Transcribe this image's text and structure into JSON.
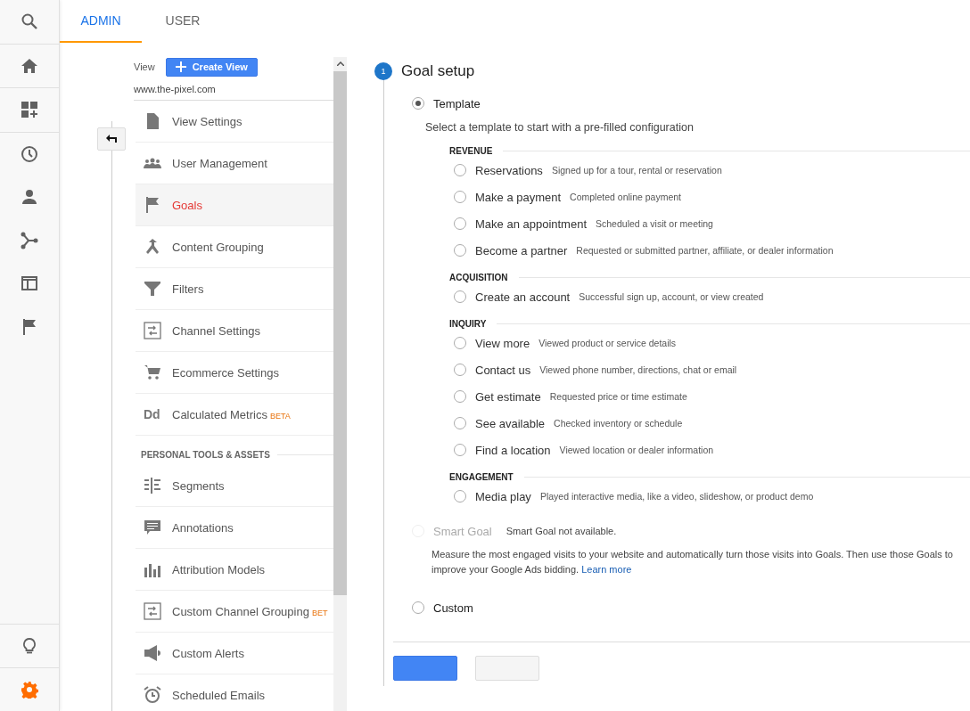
{
  "rail": {
    "top": [
      {
        "kind": "search",
        "selected": false
      },
      {
        "kind": "home",
        "selected": false
      },
      {
        "kind": "dashboard",
        "selected": false
      },
      {
        "kind": "clock",
        "selected": false
      },
      {
        "kind": "person",
        "selected": false
      },
      {
        "kind": "share",
        "selected": false
      },
      {
        "kind": "layout",
        "selected": false
      },
      {
        "kind": "flag",
        "selected": false
      }
    ],
    "bottom": [
      {
        "kind": "bulb",
        "selected": false
      },
      {
        "kind": "gear",
        "selected": true
      }
    ]
  },
  "tabs": [
    {
      "label": "ADMIN",
      "selected": true
    },
    {
      "label": "USER",
      "selected": false
    }
  ],
  "view_panel": {
    "label": "View",
    "create_button": "Create View",
    "view_name": "www.the-pixel.com",
    "groups": [
      {
        "items": [
          {
            "label": "View Settings",
            "kind": "doc",
            "selected": false
          },
          {
            "label": "User Management",
            "kind": "people",
            "selected": false
          },
          {
            "label": "Goals",
            "kind": "flag",
            "selected": true
          },
          {
            "label": "Content Grouping",
            "kind": "merge",
            "selected": false
          },
          {
            "label": "Filters",
            "kind": "filter",
            "selected": false
          },
          {
            "label": "Channel Settings",
            "kind": "channel",
            "selected": false
          },
          {
            "label": "Ecommerce Settings",
            "kind": "cart",
            "selected": false
          },
          {
            "label": "Calculated Metrics",
            "kind": "dd",
            "icon_text": "Dd",
            "selected": false,
            "badge": "BETA"
          }
        ]
      },
      {
        "heading": "PERSONAL TOOLS & ASSETS",
        "items": [
          {
            "label": "Segments",
            "kind": "segments",
            "selected": false
          },
          {
            "label": "Annotations",
            "kind": "comment",
            "selected": false
          },
          {
            "label": "Attribution Models",
            "kind": "bars",
            "selected": false
          },
          {
            "label": "Custom Channel Grouping",
            "kind": "channel",
            "selected": false,
            "badge": "BET"
          },
          {
            "label": "Custom Alerts",
            "kind": "megaphone",
            "selected": false
          },
          {
            "label": "Scheduled Emails",
            "kind": "alarm",
            "selected": false
          }
        ]
      }
    ]
  },
  "goal_setup": {
    "step": "1",
    "title": "Goal setup",
    "options": [
      {
        "kind": "template",
        "label": "Template",
        "selected": true,
        "disabled": false,
        "description": "Select a template to start with a pre-filled configuration",
        "categories": [
          {
            "name": "REVENUE",
            "templates": [
              {
                "label": "Reservations",
                "description": "Signed up for a tour, rental or reservation",
                "selected": false
              },
              {
                "label": "Make a payment",
                "description": "Completed online payment",
                "selected": false
              },
              {
                "label": "Make an appointment",
                "description": "Scheduled a visit or meeting",
                "selected": false
              },
              {
                "label": "Become a partner",
                "description": "Requested or submitted partner, affiliate, or dealer information",
                "selected": false
              }
            ]
          },
          {
            "name": "ACQUISITION",
            "templates": [
              {
                "label": "Create an account",
                "description": "Successful sign up, account, or view created",
                "selected": false
              }
            ]
          },
          {
            "name": "INQUIRY",
            "templates": [
              {
                "label": "View more",
                "description": "Viewed product or service details",
                "selected": false
              },
              {
                "label": "Contact us",
                "description": "Viewed phone number, directions, chat or email",
                "selected": false
              },
              {
                "label": "Get estimate",
                "description": "Requested price or time estimate",
                "selected": false
              },
              {
                "label": "See available",
                "description": "Checked inventory or schedule",
                "selected": false
              },
              {
                "label": "Find a location",
                "description": "Viewed location or dealer information",
                "selected": false
              }
            ]
          },
          {
            "name": "ENGAGEMENT",
            "templates": [
              {
                "label": "Media play",
                "description": "Played interactive media, like a video, slideshow, or product demo",
                "selected": false
              }
            ]
          }
        ]
      },
      {
        "kind": "smart",
        "label": "Smart Goal",
        "selected": false,
        "disabled": true,
        "note": "Smart Goal not available.",
        "description": "Measure the most engaged visits to your website and automatically turn those visits into Goals. Then use those Goals to improve your Google Ads bidding.",
        "link": "Learn more"
      },
      {
        "kind": "custom",
        "label": "Custom",
        "selected": false,
        "disabled": false
      }
    ],
    "buttons": [
      {
        "kind": "primary"
      },
      {
        "kind": "secondary"
      }
    ]
  }
}
